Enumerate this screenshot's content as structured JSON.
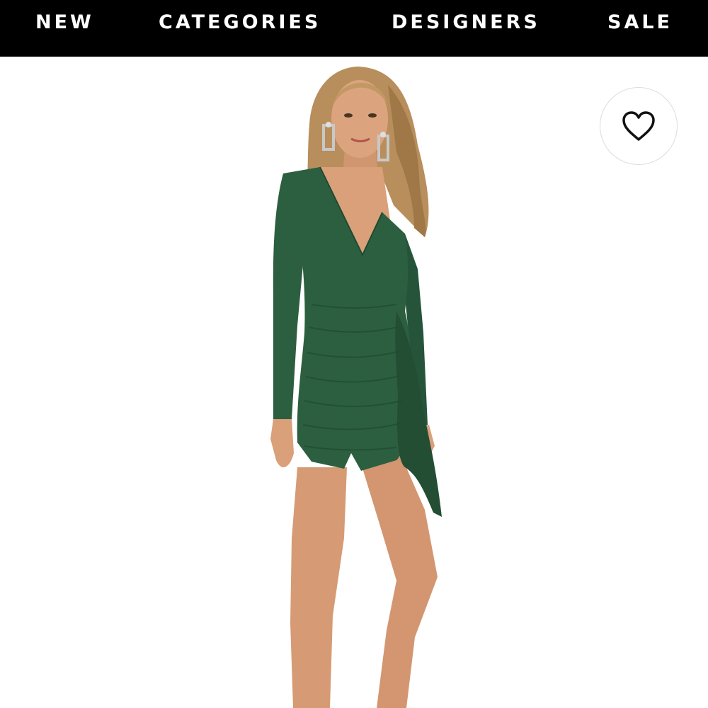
{
  "nav": {
    "items": [
      {
        "label": "NEW"
      },
      {
        "label": "CATEGORIES"
      },
      {
        "label": "DESIGNERS"
      },
      {
        "label": "SALE"
      }
    ]
  },
  "product": {
    "image_alt": "Model wearing a long-sleeve green deep V-neck ruched mini dress with draped side panel",
    "dress_color": "#2c5f3f",
    "skin_color": "#d9a07a",
    "hair_color": "#b88e5c"
  },
  "favorite": {
    "icon": "heart-outline-icon"
  },
  "colors": {
    "nav_background": "#000000",
    "nav_text": "#ffffff",
    "page_background": "#ffffff"
  }
}
